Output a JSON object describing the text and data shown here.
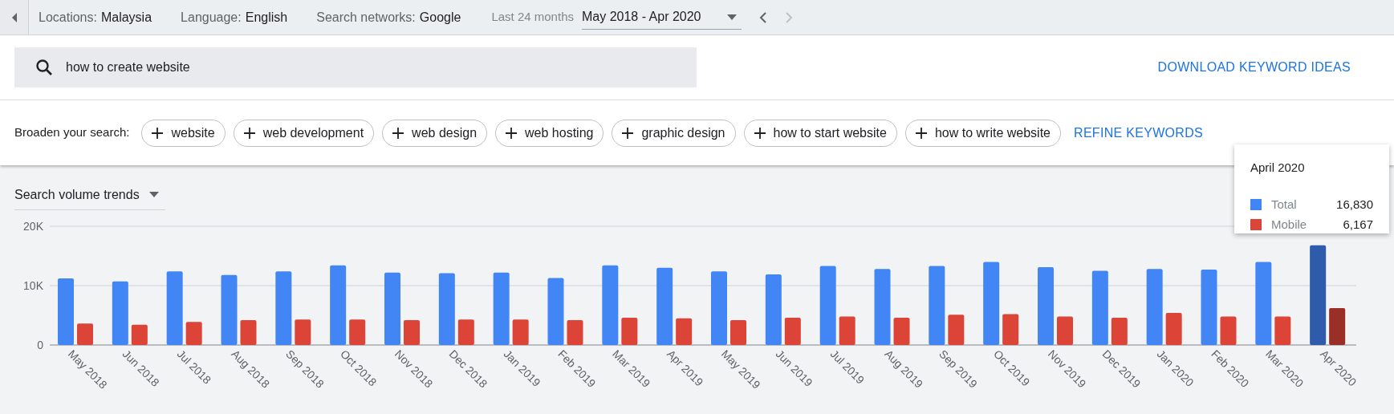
{
  "top_bar": {
    "filters": [
      {
        "label": "Locations:",
        "value": "Malaysia"
      },
      {
        "label": "Language:",
        "value": "English"
      },
      {
        "label": "Search networks:",
        "value": "Google"
      }
    ],
    "range_label": "Last 24 months",
    "range_value": "May 2018 - Apr 2020"
  },
  "search": {
    "value": "how to create website"
  },
  "download_link": "DOWNLOAD KEYWORD IDEAS",
  "broaden": {
    "label": "Broaden your search:",
    "chips": [
      "website",
      "web development",
      "web design",
      "web hosting",
      "graphic design",
      "how to start website",
      "how to write website"
    ]
  },
  "refine_link": "REFINE KEYWORDS",
  "trends": {
    "selector": "Search volume trends",
    "chart_data": {
      "type": "bar",
      "categories": [
        "May 2018",
        "Jun 2018",
        "Jul 2018",
        "Aug 2018",
        "Sep 2018",
        "Oct 2018",
        "Nov 2018",
        "Dec 2018",
        "Jan 2019",
        "Feb 2019",
        "Mar 2019",
        "Apr 2019",
        "May 2019",
        "Jun 2019",
        "Jul 2019",
        "Aug 2019",
        "Sep 2019",
        "Oct 2019",
        "Nov 2019",
        "Dec 2019",
        "Jan 2020",
        "Feb 2020",
        "Mar 2020",
        "Apr 2020"
      ],
      "series": [
        {
          "name": "Total",
          "color": "#4285f4",
          "values": [
            11200,
            10700,
            12400,
            11800,
            12400,
            13400,
            12200,
            12100,
            12200,
            11300,
            13400,
            13000,
            12400,
            11900,
            13300,
            12800,
            13300,
            14000,
            13100,
            12500,
            12800,
            12700,
            14000,
            16800
          ]
        },
        {
          "name": "Mobile",
          "color": "#db4437",
          "values": [
            3600,
            3400,
            3900,
            4200,
            4300,
            4300,
            4200,
            4300,
            4300,
            4200,
            4600,
            4500,
            4200,
            4600,
            4800,
            4600,
            5100,
            5200,
            4800,
            4600,
            5400,
            4800,
            4800,
            6200
          ]
        }
      ],
      "ylim": [
        0,
        20000
      ],
      "yticks": [
        {
          "value": 0,
          "label": "0"
        },
        {
          "value": 10000,
          "label": "10K"
        },
        {
          "value": 20000,
          "label": "20K"
        }
      ]
    },
    "tooltip": {
      "title": "April 2020",
      "hovered": true,
      "values": [
        "16,830",
        "6,167"
      ]
    }
  }
}
